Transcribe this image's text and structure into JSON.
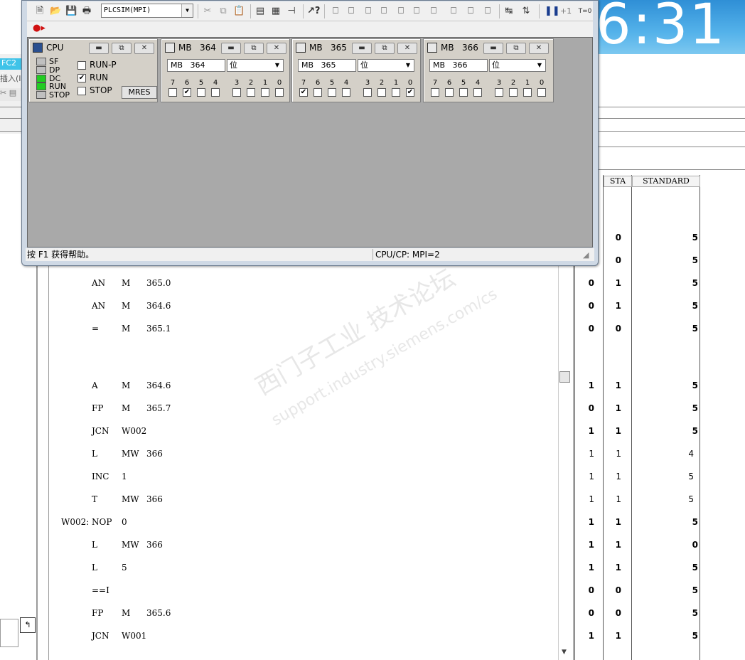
{
  "desktop": {
    "clock_text": "6:31"
  },
  "background_editor": {
    "tab_label": "FC2 -",
    "insert_label": "插入(I",
    "columns": [
      {
        "label": "STA"
      },
      {
        "label": "STANDARD"
      }
    ],
    "code_rows": [
      {
        "label": "",
        "op": "AN",
        "a1": "M",
        "a2": "365.0",
        "c1": "0",
        "c2": "1",
        "c3": "5",
        "bold": true
      },
      {
        "label": "",
        "op": "AN",
        "a1": "M",
        "a2": "364.6",
        "c1": "0",
        "c2": "1",
        "c3": "5",
        "bold": true
      },
      {
        "label": "",
        "op": "=",
        "a1": "M",
        "a2": "365.1",
        "c1": "0",
        "c2": "0",
        "c3": "5",
        "bold": true
      },
      {
        "label": "",
        "op": "",
        "a1": "",
        "a2": "",
        "c1": "",
        "c2": "",
        "c3": "",
        "bold": true
      },
      {
        "label": "",
        "op": "A",
        "a1": "M",
        "a2": "364.6",
        "c1": "1",
        "c2": "1",
        "c3": "5",
        "bold": true
      },
      {
        "label": "",
        "op": "FP",
        "a1": "M",
        "a2": "365.7",
        "c1": "0",
        "c2": "1",
        "c3": "5",
        "bold": true
      },
      {
        "label": "",
        "op": "JCN",
        "a1": "W002",
        "a2": "",
        "c1": "1",
        "c2": "1",
        "c3": "5",
        "bold": true
      },
      {
        "label": "",
        "op": "L",
        "a1": "MW",
        "a2": "366",
        "c1": "1",
        "c2": "1",
        "c3": "4",
        "bold": false
      },
      {
        "label": "",
        "op": "INC",
        "a1": "1",
        "a2": "",
        "c1": "1",
        "c2": "1",
        "c3": "5",
        "bold": false
      },
      {
        "label": "",
        "op": "T",
        "a1": "MW",
        "a2": "366",
        "c1": "1",
        "c2": "1",
        "c3": "5",
        "bold": false
      },
      {
        "label": "W002:",
        "op": "NOP",
        "a1": "0",
        "a2": "",
        "c1": "1",
        "c2": "1",
        "c3": "5",
        "bold": true
      },
      {
        "label": "",
        "op": "L",
        "a1": "MW",
        "a2": "366",
        "c1": "1",
        "c2": "1",
        "c3": "0",
        "bold": true
      },
      {
        "label": "",
        "op": "L",
        "a1": "5",
        "a2": "",
        "c1": "1",
        "c2": "1",
        "c3": "5",
        "bold": true
      },
      {
        "label": "",
        "op": "==I",
        "a1": "",
        "a2": "",
        "c1": "0",
        "c2": "0",
        "c3": "5",
        "bold": true
      },
      {
        "label": "",
        "op": "FP",
        "a1": "M",
        "a2": "365.6",
        "c1": "0",
        "c2": "0",
        "c3": "5",
        "bold": true
      },
      {
        "label": "",
        "op": "JCN",
        "a1": "W001",
        "a2": "",
        "c1": "1",
        "c2": "1",
        "c3": "5",
        "bold": true
      }
    ],
    "upper_values": [
      {
        "c2": "0",
        "c3": "5"
      },
      {
        "c2": "0",
        "c3": "5"
      }
    ]
  },
  "plcsim": {
    "plc_select": "PLCSIM(MPI)",
    "toolbar_counter": "+1",
    "toolbar_t0": "T=0",
    "status_help": "按 F1 获得帮助。",
    "status_cpu": "CPU/CP:  MPI=2",
    "cpu_window": {
      "title": "CPU",
      "leds": [
        {
          "label": "SF",
          "color": "#c0c0c0"
        },
        {
          "label": "DP",
          "color": "#c0c0c0"
        },
        {
          "label": "DC",
          "color": "#22cc22"
        },
        {
          "label": "RUN",
          "color": "#22cc22"
        },
        {
          "label": "STOP",
          "color": "#c0c0c0"
        }
      ],
      "modes": [
        {
          "label": "RUN-P",
          "checked": false
        },
        {
          "label": "RUN",
          "checked": true
        },
        {
          "label": "STOP",
          "checked": false
        }
      ],
      "mres_label": "MRES"
    },
    "mb_windows": [
      {
        "title": "MB   364",
        "address": "MB   364",
        "format": "位",
        "bits_checked": [
          false,
          true,
          false,
          false,
          false,
          false,
          false,
          false
        ]
      },
      {
        "title": "MB   365",
        "address": "MB   365",
        "format": "位",
        "bits_checked": [
          true,
          false,
          false,
          false,
          false,
          false,
          false,
          true
        ]
      },
      {
        "title": "MB   366",
        "address": "MB   366",
        "format": "位",
        "bits_checked": [
          false,
          false,
          false,
          false,
          false,
          false,
          false,
          false
        ]
      }
    ],
    "bit_labels": [
      "7",
      "6",
      "5",
      "4",
      "3",
      "2",
      "1",
      "0"
    ]
  },
  "watermark": {
    "line1": "西门子工业  技术论坛",
    "line2": "support.industry.siemens.com/cs"
  }
}
